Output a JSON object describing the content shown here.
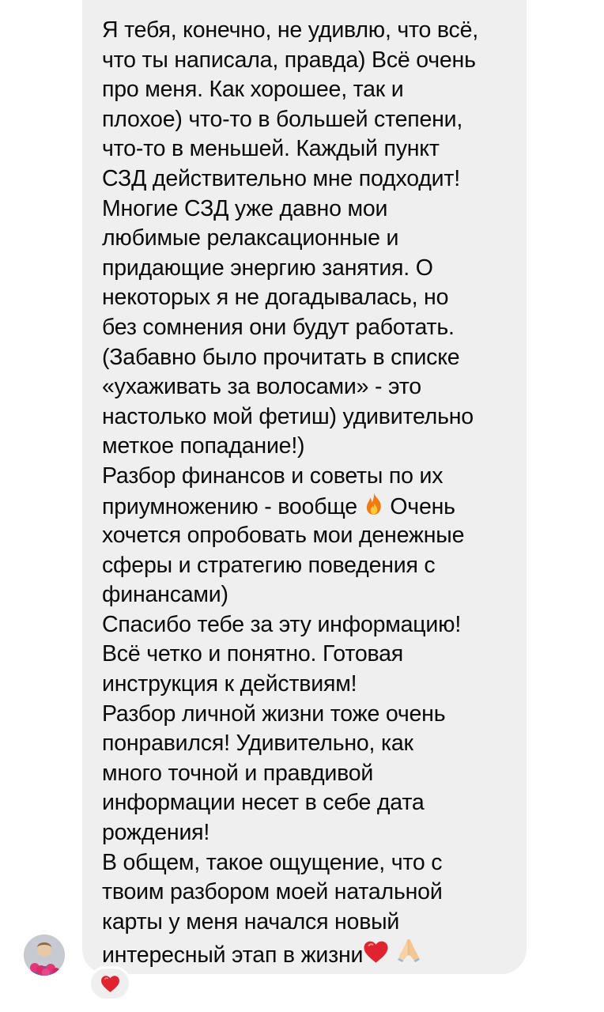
{
  "message": {
    "lines": [
      "Я тебя, конечно, не удивлю, что всё,",
      "что ты написала, правда) Всё очень",
      "про меня. Как хорошее, так и",
      "плохое) что-то в большей степени,",
      "что-то в меньшей. Каждый пункт",
      "СЗД действительно мне подходит!",
      "Многие СЗД уже давно мои",
      "любимые релаксационные и",
      "придающие энергию занятия. О",
      "некоторых я не догадывалась, но",
      "без сомнения они будут работать.",
      "(Забавно было прочитать в списке",
      "«ухаживать за волосами» - это",
      "настолько мой фетиш) удивительно",
      "меткое попадание!)",
      "Разбор финансов и советы по их",
      "приумножению - вообще",
      "хочется опробовать мои денежные",
      "сферы и стратегию поведения с",
      "финансами)",
      "Спасибо тебе за эту информацию!",
      "Всё четко и понятно. Готовая",
      "инструкция к действиям!",
      "Разбор личной жизни тоже очень",
      "понравился! Удивительно, как",
      "много точной и правдивой",
      "информации несет в себе дата",
      "рождения!",
      "В общем, такое ощущение, что с",
      "твоим разбором моей натальной",
      "карты у меня начался новый",
      "интересный этап в жизни"
    ],
    "fire_continuation": "Очень",
    "colors": {
      "bubble": "#efeff0",
      "text": "#0a0a0a",
      "heart": "#e0242f",
      "fire": "#f07a16"
    }
  },
  "reactions": {
    "reaction_icon": "heart-icon"
  },
  "sender": {
    "avatar_icon": "avatar"
  }
}
